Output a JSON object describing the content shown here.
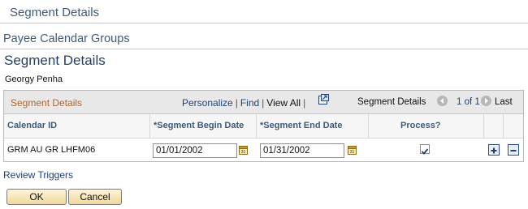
{
  "header": {
    "title": "Segment Details"
  },
  "nav": {
    "payee_calendar_groups": "Payee Calendar Groups"
  },
  "page": {
    "heading": "Segment Details",
    "person_name": "Georgy Penha"
  },
  "grid": {
    "caption": "Segment Details",
    "personalize": "Personalize",
    "find": "Find",
    "view_all": "View All",
    "separator": "|",
    "pager_label": "Segment Details",
    "pager_count": "1 of 1",
    "pager_last": "Last",
    "columns": {
      "calendar_id": "Calendar ID",
      "segment_begin": "*Segment Begin Date",
      "segment_end": "*Segment End Date",
      "process": "Process?"
    },
    "rows": [
      {
        "calendar_id": "GRM AU GR LHFM06",
        "begin_date": "01/01/2002",
        "end_date": "01/31/2002",
        "process_checked": true
      }
    ]
  },
  "links": {
    "review_triggers": "Review Triggers"
  },
  "buttons": {
    "ok": "OK",
    "cancel": "Cancel"
  },
  "colors": {
    "link": "#1f3f77",
    "title": "#3e5a78",
    "caption": "#b5642a"
  },
  "icons": {
    "download": "download-icon",
    "calendar": "calendar-icon",
    "add": "plus-icon",
    "delete": "minus-icon"
  }
}
